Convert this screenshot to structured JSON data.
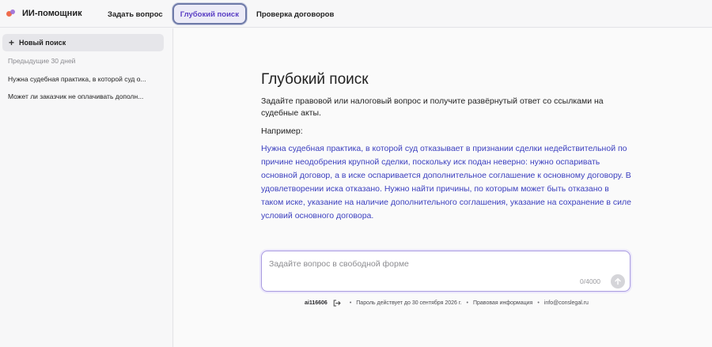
{
  "header": {
    "brand": "ИИ-помощник",
    "tabs": [
      {
        "label": "Задать вопрос",
        "active": false
      },
      {
        "label": "Глубокий поиск",
        "active": true
      },
      {
        "label": "Проверка договоров",
        "active": false
      }
    ]
  },
  "sidebar": {
    "new_search_label": "Новый поиск",
    "section_label": "Предыдущие 30 дней",
    "history": [
      "Нужна судебная практика, в которой суд о...",
      "Может ли заказчик не оплачивать дополн..."
    ]
  },
  "main": {
    "title": "Глубокий поиск",
    "intro": "Задайте правовой или налоговый вопрос и получите развёрнутый ответ со ссылками на судебные акты.",
    "example_label": "Например:",
    "example_text": "Нужна судебная практика, в которой суд отказывает в признании сделки недействительной по причине неодобрения крупной сделки, поскольку иск подан неверно: нужно оспаривать основной договор, а в иске оспаривается дополнительное соглашение к основному договору. В удовлетворении иска отказано. Нужно найти причины, по которым может быть отказано в таком иске, указание на наличие дополнительного соглашения, указание на сохранение в силе условий основного договора."
  },
  "composer": {
    "placeholder": "Задайте вопрос в свободной форме",
    "value": "",
    "char_count": "0/4000"
  },
  "footer": {
    "user": "ai116606",
    "password_note": "Пароль действует до 30 сентября 2026 г.",
    "legal_link": "Правовая информация",
    "email": "info@conslegal.ru",
    "separator": "•"
  },
  "colors": {
    "accent": "#5a3fc4",
    "example_link": "#3b3fbf",
    "logo_orange": "#ef6c4d",
    "logo_purple": "#9b6bd6"
  },
  "icons": {
    "new_search": "plus-icon",
    "logout": "logout-icon",
    "send": "arrow-up-icon"
  }
}
